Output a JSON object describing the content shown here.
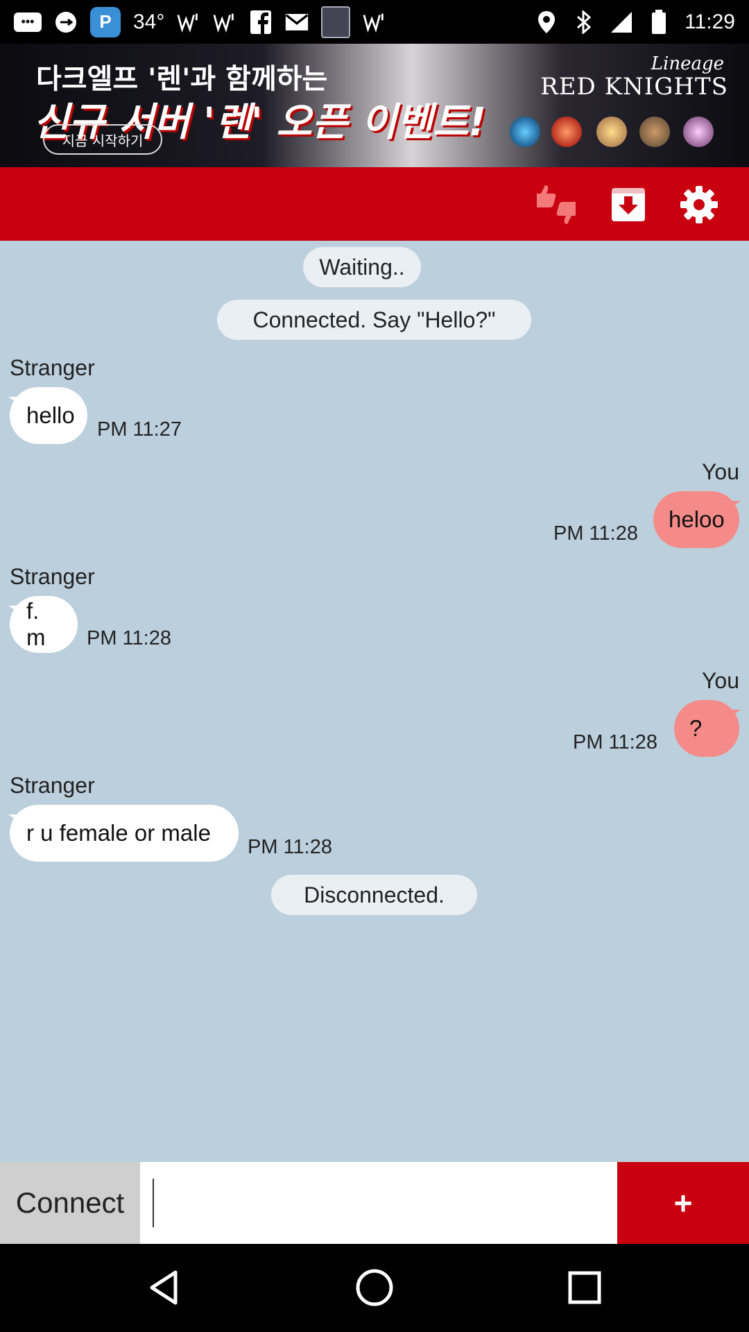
{
  "status_bar": {
    "temperature": "34°",
    "time": "11:29",
    "icons": [
      "chat-icon",
      "usb-icon",
      "p-app-icon",
      "signal-icon",
      "signal-icon",
      "facebook-icon",
      "gmail-icon",
      "bible-icon",
      "signal-icon",
      "location-icon",
      "bluetooth-icon",
      "cellular-icon",
      "battery-icon"
    ]
  },
  "ad": {
    "line1": "다크엘프 '렌'과 함께하는",
    "line2": "신규 서버 '렌' 오픈 이벤트!",
    "cta": "지금 시작하기",
    "brand_top": "Lineage",
    "brand": "RED KNIGHTS"
  },
  "toolbar": {
    "icons": [
      "thumbs-rating-icon",
      "save-download-icon",
      "settings-gear-icon"
    ],
    "accent": "#c8000f"
  },
  "chat": {
    "system": {
      "waiting": "Waiting..",
      "connected": "Connected. Say \"Hello?\"",
      "disconnected": "Disconnected."
    },
    "messages": [
      {
        "sender": "Stranger",
        "text": "hello",
        "time": "PM 11:27"
      },
      {
        "sender": "You",
        "text": "heloo",
        "time": "PM 11:28"
      },
      {
        "sender": "Stranger",
        "text": "f. m",
        "time": "PM 11:28"
      },
      {
        "sender": "You",
        "text": "?",
        "time": "PM 11:28"
      },
      {
        "sender": "Stranger",
        "text": "r u female or male",
        "time": "PM 11:28"
      }
    ],
    "colors": {
      "background": "#bccfdc",
      "stranger_bubble": "#ffffff",
      "you_bubble": "#f58b88"
    }
  },
  "input_bar": {
    "connect_label": "Connect",
    "message_value": "",
    "add_label": "+"
  },
  "nav_bar": {
    "icons": [
      "back-icon",
      "home-icon",
      "recents-icon"
    ]
  }
}
